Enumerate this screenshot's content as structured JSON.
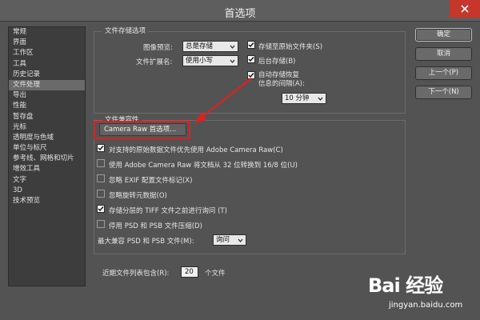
{
  "window": {
    "title": "首选项"
  },
  "sidebar": {
    "items": [
      {
        "label": "常规"
      },
      {
        "label": "界面"
      },
      {
        "label": "工作区"
      },
      {
        "label": "工具"
      },
      {
        "label": "历史记录"
      },
      {
        "label": "文件处理",
        "active": true
      },
      {
        "label": "导出"
      },
      {
        "label": "性能"
      },
      {
        "label": "暂存盘"
      },
      {
        "label": "光标"
      },
      {
        "label": "透明度与色域"
      },
      {
        "label": "单位与标尺"
      },
      {
        "label": "参考线、网格和切片"
      },
      {
        "label": "增效工具"
      },
      {
        "label": "文字"
      },
      {
        "label": "3D"
      },
      {
        "label": "技术预览"
      }
    ]
  },
  "file_save": {
    "group_label": "文件存储选项",
    "image_preview_label": "图像预览:",
    "image_preview_value": "总是存储",
    "ext_label": "文件扩展名:",
    "ext_value": "使用小写",
    "save_original_folder": {
      "label": "存储至原始文件夹(S)",
      "checked": true
    },
    "background_save": {
      "label": "后台存储(B)",
      "checked": true
    },
    "auto_save": {
      "label_line1": "自动存储恢复",
      "label_line2": "信息的间隔(A):",
      "checked": true
    },
    "interval_value": "10 分钟"
  },
  "compat": {
    "group_label": "文件兼容性",
    "camera_raw_button": "Camera Raw 首选项...",
    "options": [
      {
        "label": "对支持的原始数据文件优先使用 Adobe Camera Raw(C)",
        "checked": true
      },
      {
        "label": "使用 Adobe Camera Raw 将文档从 32 位转换到 16/8 位(U)",
        "checked": false
      },
      {
        "label": "忽略 EXIF 配置文件标记(X)",
        "checked": false
      },
      {
        "label": "忽略旋转元数据(O)",
        "checked": false
      },
      {
        "label": "存储分层的 TIFF 文件之前进行询问 (T)",
        "checked": true
      },
      {
        "label": "停用 PSD 和 PSB 文件压缩(D)",
        "checked": false
      }
    ],
    "max_compat_label": "最大兼容 PSD 和 PSB 文件(M):",
    "max_compat_value": "询问"
  },
  "recent": {
    "label": "近期文件列表包含(R):",
    "value": "20",
    "unit": "个文件"
  },
  "buttons": {
    "ok": "确定",
    "cancel": "取消",
    "prev": "上一个(P)",
    "next": "下一个(N)"
  },
  "watermark": {
    "logo": "Bai 经验",
    "url": "jingyan.baidu.com"
  },
  "colors": {
    "accent_red": "#e02020",
    "dialog_bg": "#535353",
    "sidebar_bg": "#3d3d3d"
  }
}
